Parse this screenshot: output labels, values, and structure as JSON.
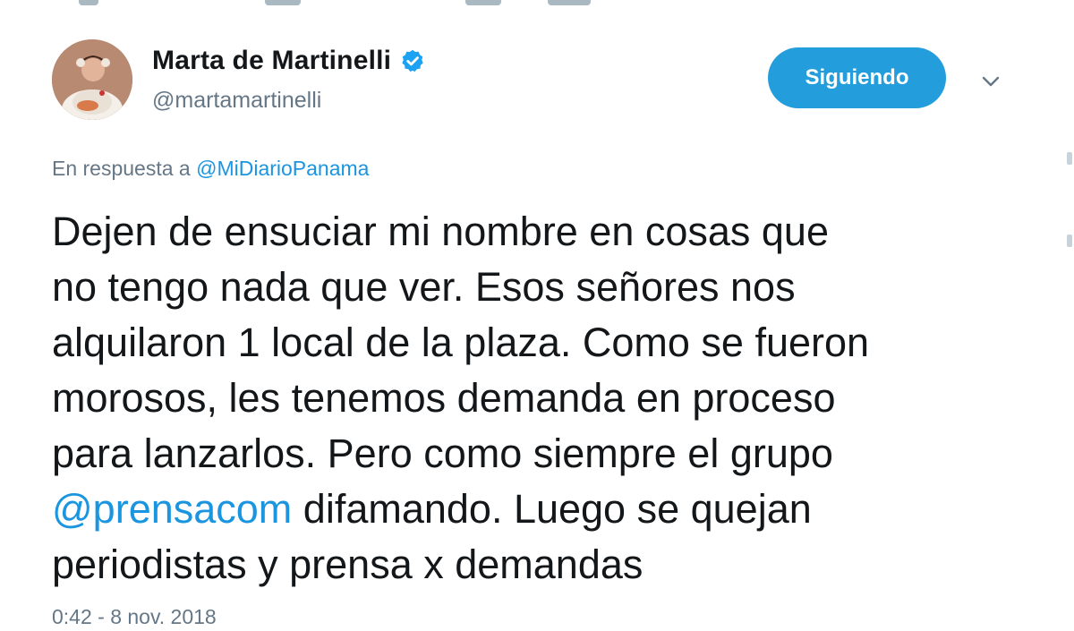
{
  "tweet": {
    "author": {
      "name": "Marta de Martinelli",
      "handle": "@martamartinelli",
      "verified": true
    },
    "follow_button_label": "Siguiendo",
    "reply_prefix": "En respuesta a",
    "reply_to": "@MiDiarioPanama",
    "text_lines": [
      {
        "before": "Dejen de ensuciar mi nombre en cosas que",
        "mention": "",
        "after": ""
      },
      {
        "before": "no tengo nada que ver. Esos señores nos",
        "mention": "",
        "after": ""
      },
      {
        "before": "alquilaron 1 local de la plaza. Como se fueron",
        "mention": "",
        "after": ""
      },
      {
        "before": "morosos, les tenemos demanda en proceso",
        "mention": "",
        "after": ""
      },
      {
        "before": "para lanzarlos. Pero como siempre el grupo",
        "mention": "",
        "after": ""
      },
      {
        "before": "",
        "mention": "@prensacom",
        "after": " difamando. Luego se quejan"
      },
      {
        "before": "periodistas y prensa x demandas",
        "mention": "",
        "after": ""
      }
    ],
    "timestamp": "0:42 - 8 nov. 2018"
  },
  "colors": {
    "link": "#1b95e0",
    "follow_button": "#239ddb",
    "secondary_text": "#657786",
    "primary_text": "#14171a"
  },
  "icons": {
    "verified": "verified-badge-icon",
    "menu": "chevron-down-icon"
  }
}
